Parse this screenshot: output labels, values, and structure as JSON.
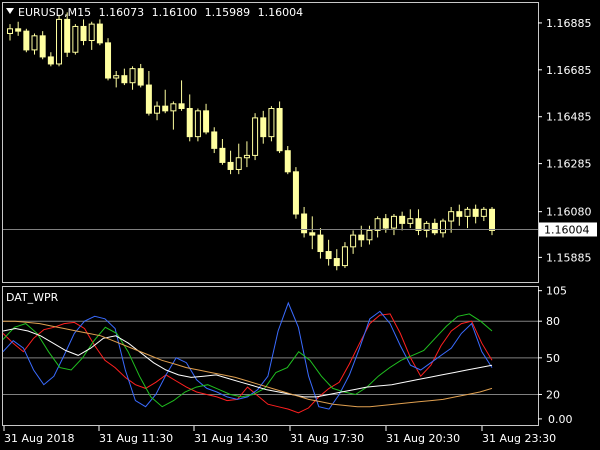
{
  "header": {
    "symbol": "EURUSD,M15",
    "open": "1.16073",
    "high": "1.16100",
    "low": "1.15989",
    "close": "1.16004"
  },
  "indicator": {
    "name": "DAT_WPR"
  },
  "colors": {
    "background": "#000000",
    "candle": "#FFFFA0",
    "grid": "#808080",
    "red": "#FF2020",
    "blue": "#3A6BFF",
    "green": "#20C020",
    "orange": "#E0A050",
    "white": "#FFFFFF"
  },
  "chart_data": [
    {
      "type": "candlestick",
      "title": "EURUSD,M15",
      "ylim": [
        1.1578,
        1.1697
      ],
      "y_ticks": [
        "1.16885",
        "1.16685",
        "1.16485",
        "1.16285",
        "1.16080",
        "1.15885"
      ],
      "y_tick_values": [
        1.16885,
        1.16685,
        1.16485,
        1.16285,
        1.1608,
        1.15885
      ],
      "current_price_label": "1.16004",
      "current_price": 1.16004,
      "x_ticks": [
        "31 Aug 2018",
        "31 Aug 11:30",
        "31 Aug 14:30",
        "31 Aug 17:30",
        "31 Aug 20:30",
        "31 Aug 23:30"
      ],
      "candles": [
        [
          1.1684,
          1.1688,
          1.1681,
          1.1686
        ],
        [
          1.1686,
          1.1689,
          1.1683,
          1.1685
        ],
        [
          1.1685,
          1.1686,
          1.1676,
          1.1677
        ],
        [
          1.1677,
          1.1684,
          1.1675,
          1.1683
        ],
        [
          1.1683,
          1.1685,
          1.1673,
          1.1674
        ],
        [
          1.1674,
          1.1676,
          1.167,
          1.1671
        ],
        [
          1.1671,
          1.1692,
          1.167,
          1.169
        ],
        [
          1.169,
          1.1693,
          1.1674,
          1.1676
        ],
        [
          1.1676,
          1.1688,
          1.1675,
          1.1687
        ],
        [
          1.1687,
          1.169,
          1.1679,
          1.1681
        ],
        [
          1.1681,
          1.1689,
          1.1677,
          1.1688
        ],
        [
          1.1688,
          1.169,
          1.1679,
          1.168
        ],
        [
          1.168,
          1.1682,
          1.1664,
          1.1665
        ],
        [
          1.1665,
          1.1668,
          1.1661,
          1.1666
        ],
        [
          1.1666,
          1.1669,
          1.1662,
          1.1663
        ],
        [
          1.1663,
          1.167,
          1.166,
          1.1669
        ],
        [
          1.1669,
          1.1671,
          1.1661,
          1.1662
        ],
        [
          1.1662,
          1.1668,
          1.1649,
          1.165
        ],
        [
          1.165,
          1.1655,
          1.1647,
          1.1653
        ],
        [
          1.1653,
          1.166,
          1.165,
          1.1651
        ],
        [
          1.1651,
          1.1655,
          1.1643,
          1.1654
        ],
        [
          1.1654,
          1.1664,
          1.1651,
          1.1652
        ],
        [
          1.1652,
          1.1658,
          1.1638,
          1.164
        ],
        [
          1.164,
          1.1652,
          1.1638,
          1.1651
        ],
        [
          1.1651,
          1.1654,
          1.1641,
          1.1642
        ],
        [
          1.1642,
          1.1644,
          1.1633,
          1.1635
        ],
        [
          1.1635,
          1.1639,
          1.1628,
          1.1629
        ],
        [
          1.1629,
          1.1634,
          1.1624,
          1.1626
        ],
        [
          1.1626,
          1.1637,
          1.1624,
          1.1631
        ],
        [
          1.1631,
          1.1638,
          1.1627,
          1.1632
        ],
        [
          1.1632,
          1.165,
          1.163,
          1.1648
        ],
        [
          1.1648,
          1.1651,
          1.1637,
          1.164
        ],
        [
          1.164,
          1.1653,
          1.1638,
          1.1652
        ],
        [
          1.1652,
          1.1655,
          1.1633,
          1.1634
        ],
        [
          1.1634,
          1.1636,
          1.1624,
          1.1625
        ],
        [
          1.1625,
          1.1627,
          1.1605,
          1.1607
        ],
        [
          1.1607,
          1.161,
          1.1597,
          1.1599
        ],
        [
          1.1599,
          1.1606,
          1.1592,
          1.1598
        ],
        [
          1.1598,
          1.1601,
          1.1588,
          1.1591
        ],
        [
          1.1591,
          1.1596,
          1.1585,
          1.1588
        ],
        [
          1.1588,
          1.1592,
          1.1583,
          1.1585
        ],
        [
          1.1585,
          1.1595,
          1.1584,
          1.1593
        ],
        [
          1.1593,
          1.16,
          1.159,
          1.1598
        ],
        [
          1.1598,
          1.1602,
          1.1593,
          1.1596
        ],
        [
          1.1596,
          1.1602,
          1.1594,
          1.16
        ],
        [
          1.16,
          1.1606,
          1.1597,
          1.1605
        ],
        [
          1.1605,
          1.1607,
          1.1599,
          1.1601
        ],
        [
          1.1601,
          1.1607,
          1.1598,
          1.1606
        ],
        [
          1.1606,
          1.1608,
          1.16,
          1.1603
        ],
        [
          1.1603,
          1.1609,
          1.1601,
          1.1605
        ],
        [
          1.1605,
          1.1609,
          1.1598,
          1.16
        ],
        [
          1.16,
          1.1604,
          1.1597,
          1.1603
        ],
        [
          1.1603,
          1.1605,
          1.1598,
          1.1599
        ],
        [
          1.1599,
          1.1605,
          1.1597,
          1.1604
        ],
        [
          1.1604,
          1.161,
          1.1599,
          1.1608
        ],
        [
          1.1608,
          1.1611,
          1.1602,
          1.1606
        ],
        [
          1.1606,
          1.161,
          1.1601,
          1.1609
        ],
        [
          1.1609,
          1.1611,
          1.1603,
          1.1606
        ],
        [
          1.1606,
          1.161,
          1.1604,
          1.1609
        ],
        [
          1.1609,
          1.161,
          1.1598,
          1.16
        ]
      ]
    },
    {
      "type": "line",
      "title": "DAT_WPR",
      "ylim": [
        -5,
        108
      ],
      "y_ticks": [
        "105",
        "80",
        "50",
        "20",
        "0.00"
      ],
      "y_tick_values": [
        105,
        80,
        50,
        20,
        0
      ],
      "levels": [
        80,
        50,
        20
      ],
      "series": [
        {
          "color": "red",
          "values": [
            70,
            62,
            55,
            66,
            73,
            75,
            78,
            79,
            74,
            60,
            48,
            42,
            34,
            28,
            25,
            30,
            36,
            31,
            26,
            22,
            20,
            18,
            15,
            16,
            26,
            19,
            12,
            10,
            8,
            5,
            9,
            18,
            25,
            30,
            45,
            62,
            78,
            85,
            86,
            70,
            50,
            35,
            44,
            60,
            72,
            78,
            80,
            62,
            48
          ]
        },
        {
          "color": "blue",
          "values": [
            55,
            64,
            58,
            40,
            28,
            35,
            52,
            70,
            80,
            84,
            82,
            74,
            40,
            15,
            10,
            20,
            36,
            50,
            46,
            32,
            25,
            22,
            18,
            16,
            18,
            24,
            35,
            72,
            95,
            75,
            35,
            10,
            8,
            20,
            36,
            58,
            82,
            88,
            78,
            60,
            44,
            40,
            46,
            52,
            58,
            70,
            78,
            55,
            42
          ]
        },
        {
          "color": "green",
          "values": [
            65,
            75,
            78,
            70,
            55,
            42,
            40,
            50,
            64,
            75,
            70,
            55,
            35,
            18,
            10,
            15,
            22,
            26,
            28,
            24,
            20,
            18,
            20,
            25,
            38,
            42,
            55,
            48,
            35,
            25,
            22,
            20,
            26,
            35,
            42,
            48,
            52,
            56,
            66,
            76,
            84,
            86,
            80,
            72
          ]
        },
        {
          "color": "white",
          "values": [
            72,
            74,
            72,
            68,
            62,
            56,
            52,
            58,
            66,
            68,
            62,
            54,
            46,
            40,
            36,
            34,
            35,
            36,
            33,
            30,
            27,
            24,
            22,
            20,
            18,
            18,
            20,
            22,
            24,
            26,
            27,
            28,
            30,
            32,
            34,
            36,
            38,
            40,
            42,
            44
          ]
        },
        {
          "color": "orange",
          "values": [
            80,
            80,
            79,
            78,
            76,
            74,
            72,
            70,
            68,
            64,
            60,
            56,
            52,
            48,
            45,
            42,
            40,
            38,
            36,
            34,
            31,
            28,
            25,
            22,
            19,
            16,
            14,
            12,
            11,
            10,
            10,
            11,
            12,
            13,
            14,
            15,
            16,
            18,
            20,
            22,
            25
          ]
        }
      ]
    }
  ]
}
